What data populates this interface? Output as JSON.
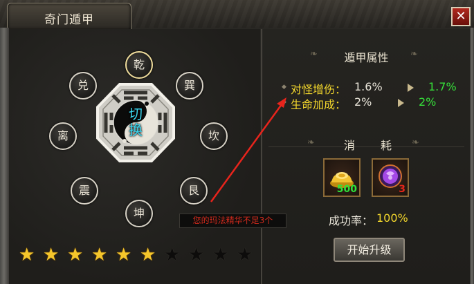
{
  "window": {
    "title": "奇门遁甲",
    "close_label": "✕"
  },
  "bagua": {
    "center_label": "切换",
    "trigrams": [
      {
        "label": "乾",
        "active": true
      },
      {
        "label": "巽",
        "active": false
      },
      {
        "label": "坎",
        "active": false
      },
      {
        "label": "艮",
        "active": false
      },
      {
        "label": "坤",
        "active": false
      },
      {
        "label": "震",
        "active": false
      },
      {
        "label": "离",
        "active": false
      },
      {
        "label": "兑",
        "active": false
      }
    ]
  },
  "stars": {
    "total": 10,
    "filled": 6
  },
  "warning": "您的玛法精华不足3个",
  "attributes": {
    "header": "遁甲属性",
    "rows": [
      {
        "label": "对怪增伤：",
        "current": "1.6%",
        "next": "1.7%"
      },
      {
        "label": "生命加成：",
        "current": "2%",
        "next": "2%"
      }
    ]
  },
  "cost": {
    "header_left": "消",
    "header_right": "耗",
    "items": [
      {
        "icon": "gold-ingot-icon",
        "count": "500",
        "count_color": "#2ee23a"
      },
      {
        "icon": "purple-gem-icon",
        "count": "3",
        "count_color": "#e6261a"
      }
    ]
  },
  "success": {
    "label": "成功率：",
    "value": "100%"
  },
  "upgrade_button": "开始升级",
  "colors": {
    "accent_yellow": "#f2d62c",
    "green": "#36e23a",
    "red": "#e6261a",
    "annotation_arrow": "#e8241c"
  }
}
